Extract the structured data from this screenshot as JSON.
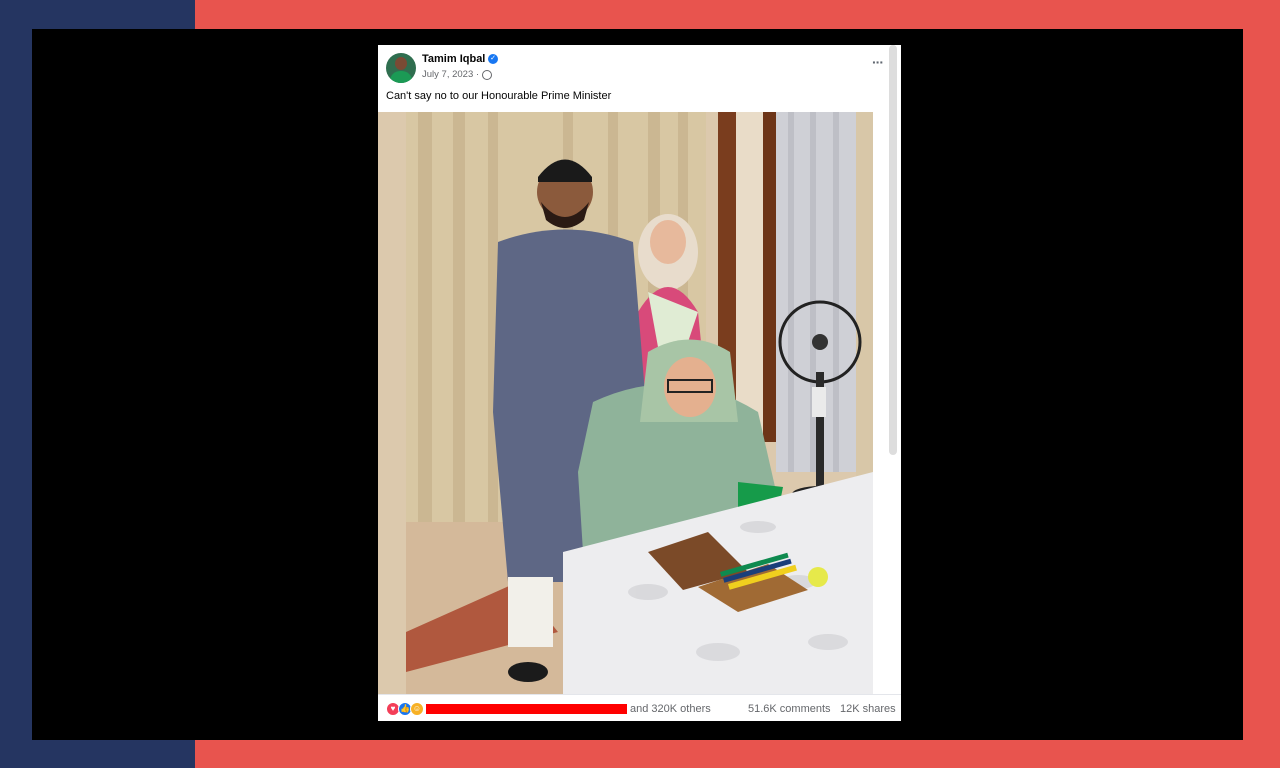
{
  "post": {
    "author": "Tamim Iqbal",
    "verified_icon": "verified-badge-icon",
    "date": "July 7, 2023 ·",
    "privacy_icon": "globe-icon",
    "more_label": "···",
    "caption": "Can't say no to our Honourable Prime Minister",
    "photo_icon": "group-photo",
    "reactions": {
      "icons": [
        "love-reaction-icon",
        "like-reaction-icon",
        "care-reaction-icon"
      ],
      "others_text": "and 320K others",
      "comments_text": "51.6K comments",
      "shares_text": "12K shares"
    }
  },
  "colors": {
    "background_red": "#e8544e",
    "background_navy": "#253561",
    "frame": "#000000",
    "redaction": "#ff0000",
    "facebook_blue": "#1877f2"
  }
}
